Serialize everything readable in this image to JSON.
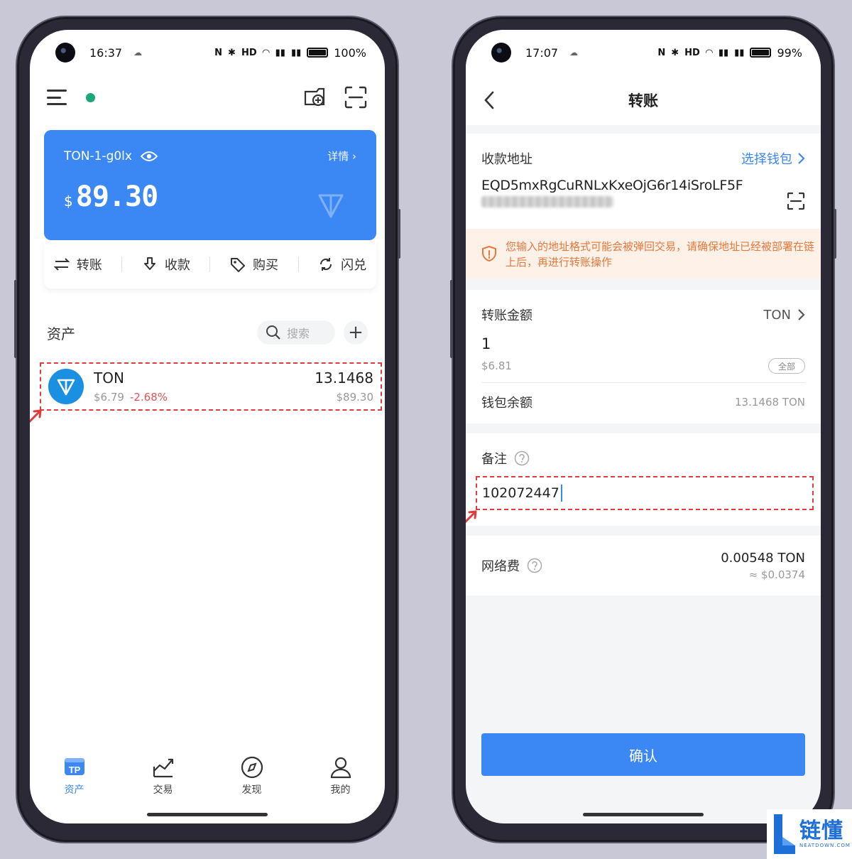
{
  "left": {
    "status": {
      "time": "16:37",
      "battery": "100%"
    },
    "wallet": {
      "name": "TON-1-g0lx",
      "details": "详情 ›",
      "currency": "$",
      "balance": "89.30"
    },
    "actions": [
      {
        "label": "转账"
      },
      {
        "label": "收款"
      },
      {
        "label": "购买"
      },
      {
        "label": "闪兑"
      }
    ],
    "assets": {
      "title": "资产",
      "search_placeholder": "搜索",
      "add": "+"
    },
    "token": {
      "name": "TON",
      "price": "$6.79",
      "change": "-2.68%",
      "amount": "13.1468",
      "usd": "$89.30"
    },
    "tabs": [
      {
        "label": "资产"
      },
      {
        "label": "交易"
      },
      {
        "label": "发现"
      },
      {
        "label": "我的"
      }
    ]
  },
  "right": {
    "status": {
      "time": "17:07",
      "battery": "99%"
    },
    "title": "转账",
    "address": {
      "label": "收款地址",
      "select_wallet": "选择钱包",
      "value": "EQD5mxRgCuRNLxKxeOjG6r14iSroLF5F"
    },
    "warning": "您输入的地址格式可能会被弹回交易，请确保地址已经被部署在链上后，再进行转账操作",
    "amount": {
      "label": "转账金额",
      "token": "TON",
      "value": "1",
      "usd": "$6.81",
      "all_button": "全部",
      "balance_label": "钱包余额",
      "balance_value": "13.1468 TON"
    },
    "memo": {
      "label": "备注",
      "value": "102072447"
    },
    "fee": {
      "label": "网络费",
      "ton": "0.00548 TON",
      "usd": "≈ $0.0374"
    },
    "confirm": "确认"
  },
  "brand": {
    "cn": "链懂",
    "en": "NEATDOWN.COM"
  },
  "colors": {
    "accent": "#3b87f3",
    "warning": "#e8773c",
    "highlight": "#e23b3b",
    "negative": "#e05454"
  }
}
